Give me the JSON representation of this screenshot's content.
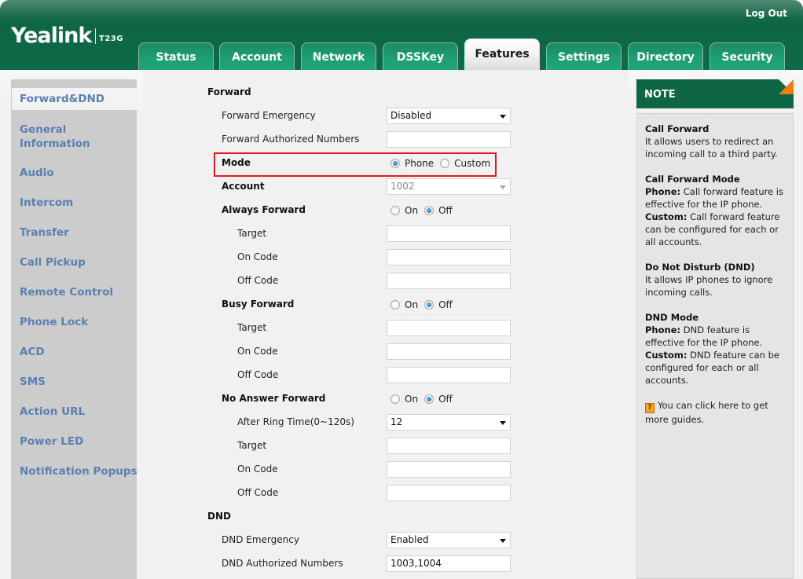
{
  "header": {
    "brand": "Yealink",
    "model": "T23G",
    "logout_label": "Log Out"
  },
  "tabs": [
    {
      "label": "Status",
      "active": false
    },
    {
      "label": "Account",
      "active": false
    },
    {
      "label": "Network",
      "active": false
    },
    {
      "label": "DSSKey",
      "active": false
    },
    {
      "label": "Features",
      "active": true
    },
    {
      "label": "Settings",
      "active": false
    },
    {
      "label": "Directory",
      "active": false
    },
    {
      "label": "Security",
      "active": false
    }
  ],
  "sidebar": {
    "items": [
      {
        "label": "Forward&DND",
        "active": true
      },
      {
        "label": "General Information",
        "active": false
      },
      {
        "label": "Audio",
        "active": false
      },
      {
        "label": "Intercom",
        "active": false
      },
      {
        "label": "Transfer",
        "active": false
      },
      {
        "label": "Call Pickup",
        "active": false
      },
      {
        "label": "Remote Control",
        "active": false
      },
      {
        "label": "Phone Lock",
        "active": false
      },
      {
        "label": "ACD",
        "active": false
      },
      {
        "label": "SMS",
        "active": false
      },
      {
        "label": "Action URL",
        "active": false
      },
      {
        "label": "Power LED",
        "active": false
      },
      {
        "label": "Notification Popups",
        "active": false
      }
    ]
  },
  "forward": {
    "title": "Forward",
    "emergency": {
      "label": "Forward Emergency",
      "value": "Disabled"
    },
    "authorized_numbers": {
      "label": "Forward Authorized Numbers",
      "value": ""
    },
    "mode": {
      "label": "Mode",
      "options": [
        "Phone",
        "Custom"
      ],
      "selected": "Phone"
    },
    "account": {
      "label": "Account",
      "value": "1002",
      "disabled": true
    },
    "always": {
      "label": "Always Forward",
      "options": [
        "On",
        "Off"
      ],
      "selected": "Off",
      "target": {
        "label": "Target",
        "value": ""
      },
      "on_code": {
        "label": "On Code",
        "value": ""
      },
      "off_code": {
        "label": "Off Code",
        "value": ""
      }
    },
    "busy": {
      "label": "Busy Forward",
      "options": [
        "On",
        "Off"
      ],
      "selected": "Off",
      "target": {
        "label": "Target",
        "value": ""
      },
      "on_code": {
        "label": "On Code",
        "value": ""
      },
      "off_code": {
        "label": "Off Code",
        "value": ""
      }
    },
    "no_answer": {
      "label": "No Answer Forward",
      "options": [
        "On",
        "Off"
      ],
      "selected": "Off",
      "ring_time": {
        "label": "After Ring Time(0~120s)",
        "value": "12"
      },
      "target": {
        "label": "Target",
        "value": ""
      },
      "on_code": {
        "label": "On Code",
        "value": ""
      },
      "off_code": {
        "label": "Off Code",
        "value": ""
      }
    }
  },
  "dnd": {
    "title": "DND",
    "emergency": {
      "label": "DND Emergency",
      "value": "Enabled"
    },
    "authorized_numbers": {
      "label": "DND Authorized Numbers",
      "value": "1003,1004"
    }
  },
  "note": {
    "title": "NOTE",
    "call_forward_title": "Call Forward",
    "call_forward_text": "It allows users to redirect an incoming call to a third party.",
    "cf_mode_title": "Call Forward Mode",
    "cf_phone_label": "Phone:",
    "cf_phone_text": "Call forward feature is effective for the IP phone.",
    "cf_custom_label": "Custom:",
    "cf_custom_text": "Call forward feature can be configured for each or all accounts.",
    "dnd_title": "Do Not Disturb (DND)",
    "dnd_text": "It allows IP phones to ignore incoming calls.",
    "dnd_mode_title": "DND Mode",
    "dnd_phone_label": "Phone:",
    "dnd_phone_text": "DND feature is effective for the IP phone.",
    "dnd_custom_label": "Custom:",
    "dnd_custom_text": "DND feature can be configured for each or all accounts.",
    "guide_text": "You can click here to get more guides.",
    "help_glyph": "?"
  },
  "colors": {
    "header_green": "#0f6644",
    "tab_green": "#1ea075",
    "sidebar_link": "#5b80b2",
    "highlight_red": "#e41a1c",
    "note_corner_orange": "#f47b0c"
  }
}
